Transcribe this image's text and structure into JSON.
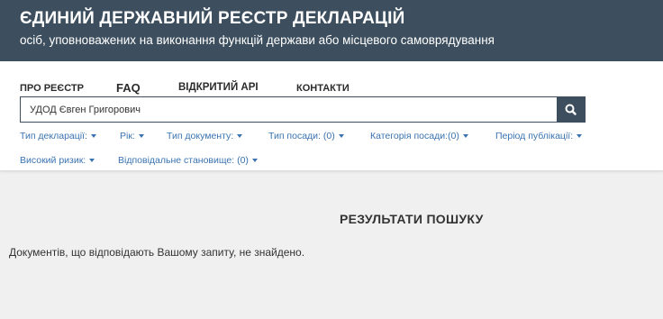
{
  "header": {
    "title": "ЄДИНИЙ ДЕРЖАВНИЙ РЕЄСТР ДЕКЛАРАЦІЙ",
    "subtitle": "осіб, уповноважених на виконання функцій держави або місцевого самоврядування"
  },
  "nav": {
    "about": "ПРО РЕЄСТР",
    "faq": "FAQ",
    "api": "ВІДКРИТИЙ API",
    "contacts": "КОНТАКТИ"
  },
  "search": {
    "value": "УДОД Євген Григорович",
    "button_icon": "search-icon"
  },
  "filters": {
    "declaration_type": "Тип декларації:",
    "year": "Рік:",
    "document_type": "Тип документу:",
    "position_type": "Тип посади: (0)",
    "position_category": "Категорія посади:(0)",
    "publication_period": "Період публікації:",
    "high_risk": "Високий ризик:",
    "responsible_position": "Відповідальне становище: (0)"
  },
  "results": {
    "title": "РЕЗУЛЬТАТИ ПОШУКУ",
    "message": "Документів, що відповідають Вашому запиту, не знайдено."
  },
  "colors": {
    "header_bg": "#3d4f5e",
    "link": "#3a73b0",
    "page_bg": "#f0f0f0"
  }
}
